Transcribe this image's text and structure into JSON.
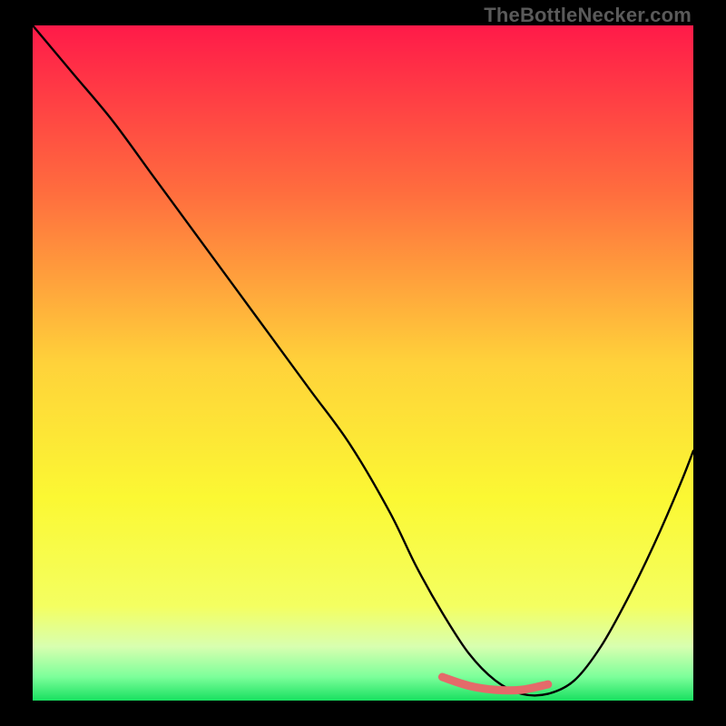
{
  "watermark": "TheBottleNecker.com",
  "chart_data": {
    "type": "line",
    "title": "",
    "xlabel": "",
    "ylabel": "",
    "xlim": [
      0,
      100
    ],
    "ylim": [
      0,
      100
    ],
    "grid": false,
    "background_gradient": {
      "stops": [
        {
          "offset": 0.0,
          "color": "#ff1a49"
        },
        {
          "offset": 0.25,
          "color": "#ff6e3e"
        },
        {
          "offset": 0.5,
          "color": "#ffd23a"
        },
        {
          "offset": 0.7,
          "color": "#fbf833"
        },
        {
          "offset": 0.86,
          "color": "#f4ff61"
        },
        {
          "offset": 0.92,
          "color": "#d8ffb0"
        },
        {
          "offset": 0.965,
          "color": "#7cff9a"
        },
        {
          "offset": 1.0,
          "color": "#18e060"
        }
      ]
    },
    "black_curve": {
      "x": [
        0,
        6,
        12,
        18,
        24,
        30,
        36,
        42,
        48,
        54,
        58,
        62,
        66,
        70,
        74,
        78,
        82,
        86,
        90,
        94,
        98,
        100
      ],
      "y": [
        100,
        93,
        86,
        78,
        70,
        62,
        54,
        46,
        38,
        28,
        20,
        13,
        7,
        3,
        1,
        1,
        3,
        8,
        15,
        23,
        32,
        37
      ]
    },
    "highlight_segment": {
      "x": [
        62,
        66,
        70,
        74,
        78
      ],
      "y": [
        3.5,
        2.2,
        1.6,
        1.6,
        2.4
      ]
    },
    "colors": {
      "curve": "#000000",
      "highlight": "#e46a6a"
    }
  }
}
